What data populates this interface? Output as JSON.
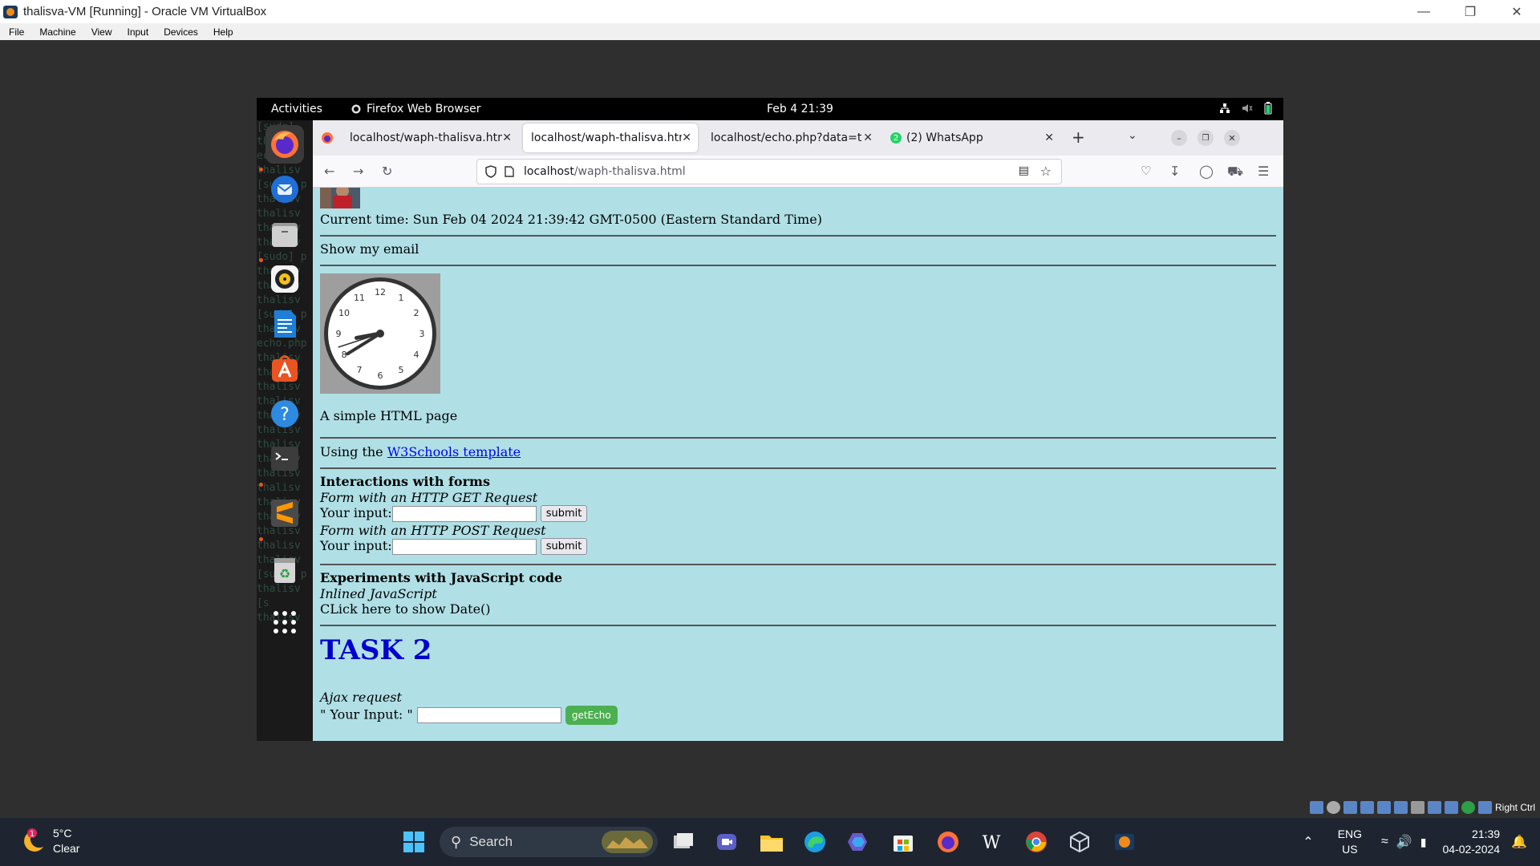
{
  "host_window": {
    "title": "thalisva-VM [Running] - Oracle VM VirtualBox",
    "menu": [
      "File",
      "Machine",
      "View",
      "Input",
      "Devices",
      "Help"
    ],
    "controls": [
      "minimize-icon",
      "restore-icon",
      "close-icon"
    ]
  },
  "guest_topbar": {
    "activities": "Activities",
    "app_name": "Firefox Web Browser",
    "clock": "Feb 4  21:39"
  },
  "dock": {
    "items": [
      "firefox",
      "thunderbird",
      "files",
      "rhythmbox",
      "libreoffice-writer",
      "app-center",
      "help",
      "terminal",
      "sublime-text",
      "trash",
      "show-apps"
    ],
    "terminal_text": "[sudo]\nthalisv\necho.ph\nthalisv\n[sudo] p\nthalisv\nthalisv\nthalisv\nthalisv\n[sudo] p\nthalisv\nthalisv\nthalisv\n[sudo] p\nthalisv\necho.php\nthalisv\nthalisv\nthalisv\nthalisv\nthalisv\nthalisv\nthalisv\nthalisv\nthalisv\nthalisv\nthalisv\nthalisv\nthalisv\nthalisv\nthalisv\n[sudo] p\nthalisv\n[s     \nthalisv"
  },
  "browser": {
    "tabs": [
      {
        "label": "localhost/waph-thalisva.htm",
        "active": false
      },
      {
        "label": "localhost/waph-thalisva.htm",
        "active": true
      },
      {
        "label": "localhost/echo.php?data=te",
        "active": false
      },
      {
        "label": "(2) WhatsApp",
        "active": false,
        "badge": "2"
      }
    ],
    "new_tab": "+",
    "url_host": "localhost",
    "url_path": "/waph-thalisva.html"
  },
  "page": {
    "current_time": "Current time: Sun Feb 04 2024 21:39:42 GMT-0500 (Eastern Standard Time)",
    "show_email": "Show my email",
    "clock_time": {
      "hour": 8,
      "minute": 39,
      "second": 42
    },
    "simple_page": "A simple HTML page",
    "using_prefix": "Using the ",
    "w3_link": "W3Schools template",
    "forms_heading": "Interactions with forms",
    "get_label": "Form with an HTTP GET Request",
    "your_input": "Your input:",
    "submit": "submit",
    "post_label": "Form with an HTTP POST Request",
    "js_heading": "Experiments with JavaScript code",
    "inlined_js": "Inlined JavaScript",
    "click_date": "CLick here to show Date()",
    "task2": "TASK 2",
    "ajax_label": "Ajax request",
    "ajax_input_label": "\" Your Input: \"",
    "get_echo": "getEcho"
  },
  "host_status": {
    "right_ctrl": "Right Ctrl"
  },
  "taskbar": {
    "weather_temp": "5°C",
    "weather_cond": "Clear",
    "weather_badge": "1",
    "search": "Search",
    "lang_top": "ENG",
    "lang_bottom": "US",
    "time": "21:39",
    "date": "04-02-2024"
  },
  "colors": {
    "page_bg": "#b0e0e6",
    "task2_color": "#0000cd",
    "getecho_green": "#4caf50",
    "ubuntu_orange": "#e95420"
  }
}
